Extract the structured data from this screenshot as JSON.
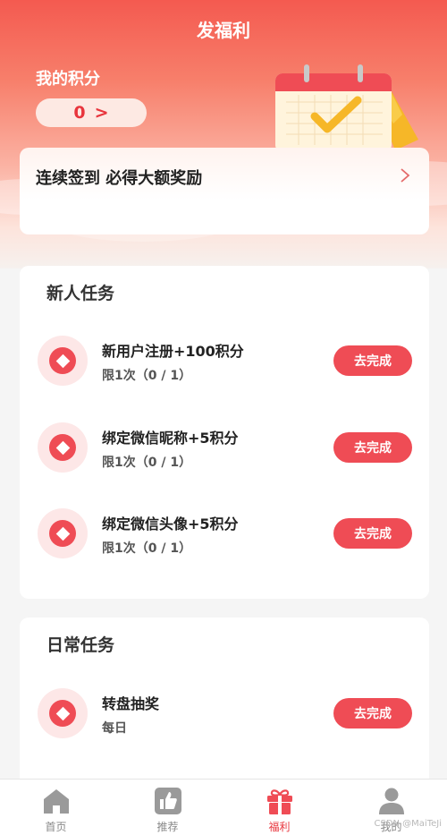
{
  "header": {
    "title": "发福利"
  },
  "points": {
    "label": "我的积分",
    "value": "0",
    "arrow": ">"
  },
  "signin": {
    "text": "连续签到 必得大额奖励"
  },
  "new_tasks": {
    "title": "新人任务",
    "items": [
      {
        "name": "新用户注册+100积分",
        "limit": "限1次（0 / 1）",
        "button": "去完成"
      },
      {
        "name": "绑定微信昵称+5积分",
        "limit": "限1次（0 / 1）",
        "button": "去完成"
      },
      {
        "name": "绑定微信头像+5积分",
        "limit": "限1次（0 / 1）",
        "button": "去完成"
      }
    ]
  },
  "daily_tasks": {
    "title": "日常任务",
    "items": [
      {
        "name": "转盘抽奖",
        "limit": "每日",
        "button": "去完成"
      }
    ]
  },
  "tabbar": {
    "items": [
      {
        "label": "首页",
        "icon": "home-icon",
        "active": false
      },
      {
        "label": "推荐",
        "icon": "thumbs-up-icon",
        "active": false
      },
      {
        "label": "福利",
        "icon": "gift-icon",
        "active": true
      },
      {
        "label": "我的",
        "icon": "user-icon",
        "active": false
      }
    ]
  },
  "watermark": "CSDN @MaiTeJi",
  "colors": {
    "accent": "#ef4c55",
    "hero_top": "#f45a50",
    "icon_bg": "#fde7e7",
    "tab_inactive": "#888888"
  }
}
